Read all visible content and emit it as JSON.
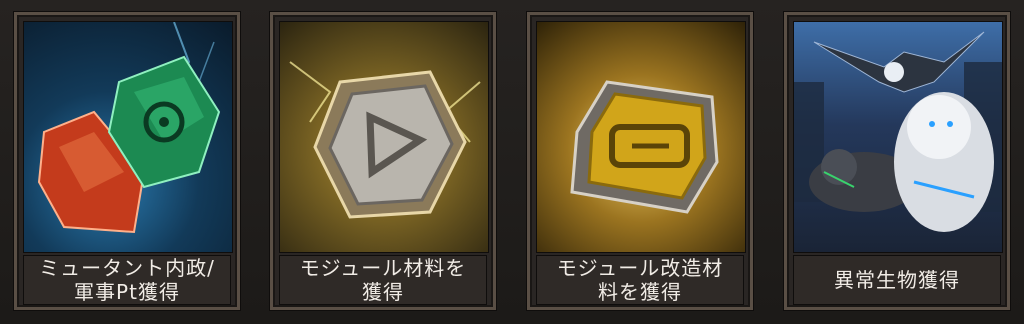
{
  "cards": [
    {
      "lines": [
        "ミュータント内政/",
        "軍事Pt獲得"
      ],
      "icon": "mutant-crystals-icon"
    },
    {
      "lines": [
        "モジュール材料を",
        "獲得"
      ],
      "icon": "module-material-icon"
    },
    {
      "lines": [
        "モジュール改造材",
        "料を獲得"
      ],
      "icon": "module-mod-chip-icon"
    },
    {
      "lines": [
        "異常生物獲得"
      ],
      "icon": "beasts-icon"
    }
  ]
}
